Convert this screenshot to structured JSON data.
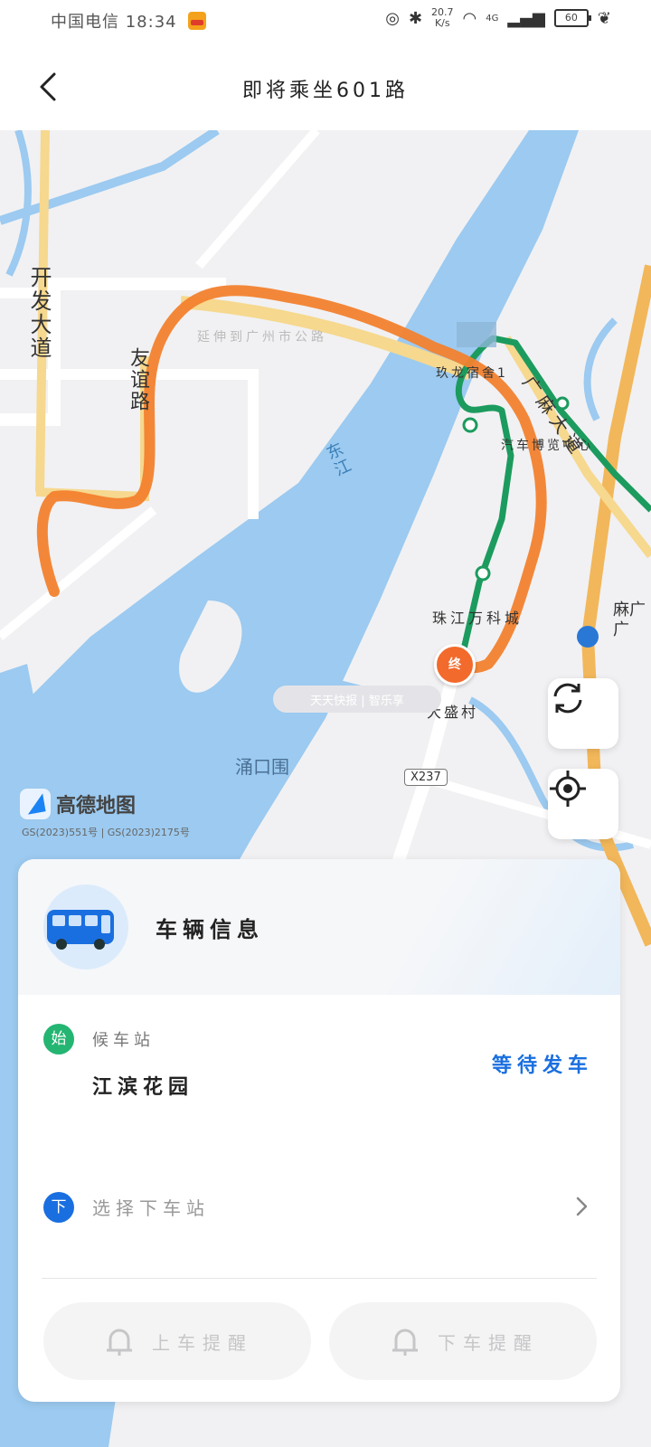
{
  "status_bar": {
    "carrier": "中国电信",
    "time": "18:34",
    "network_speed": "20.7",
    "network_speed_unit": "K/s",
    "network_type": "4G",
    "battery": "60"
  },
  "header": {
    "title": "即将乘坐601路"
  },
  "map": {
    "labels": {
      "kaifa_road": "开发大道",
      "yousuo_road": "友谊路",
      "dongjiang": "东江",
      "chongkouwei": "涌口围",
      "zhujiang_wancheng": "珠江万科城",
      "dasheng_village": "大盛村",
      "jiulong_dorm": "玖龙宿舍1",
      "guangma_road": "广麻大道",
      "auto_museum": "汽车博览中心",
      "extension_road": "延伸到广州市公路",
      "road_code": "X237",
      "ma_label": "麻广广"
    },
    "logo_text": "高德地图",
    "approval_text": "GS(2023)551号 | GS(2023)2175号",
    "watermark": "天天快报 | 智乐享",
    "terminal_marker": "终",
    "colors": {
      "route_orange": "#f2812e",
      "route_green": "#1c9b5e",
      "river": "#9ccaf0",
      "main_road": "#f2b75a"
    }
  },
  "card": {
    "title": "车辆信息",
    "start_badge": "始",
    "wait_label": "候车站",
    "station_name": "江滨花园",
    "status": "等待发车",
    "down_badge": "下",
    "select_stop": "选择下车站",
    "boarding_reminder": "上车提醒",
    "alight_reminder": "下车提醒"
  }
}
